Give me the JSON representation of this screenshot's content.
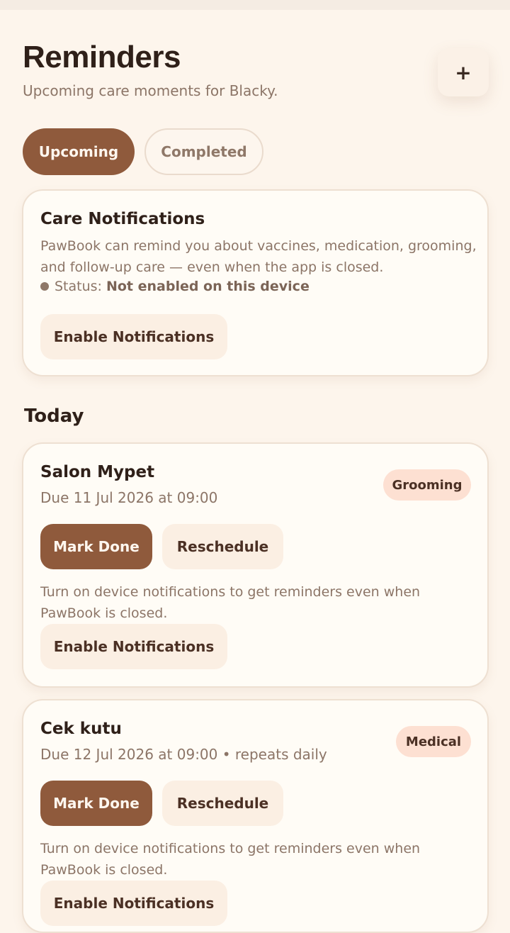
{
  "header": {
    "title": "Reminders",
    "subtitle": "Upcoming care moments for Blacky.",
    "add_label": "+"
  },
  "tabs": [
    {
      "label": "Upcoming",
      "active": true
    },
    {
      "label": "Completed",
      "active": false
    }
  ],
  "notifications_card": {
    "title": "Care Notifications",
    "description": "PawBook can remind you about vaccines, medication, grooming, and follow-up care — even when the app is closed.",
    "status_label": "Status:",
    "status_value": "Not enabled on this device",
    "button_label": "Enable Notifications"
  },
  "section": {
    "heading": "Today"
  },
  "reminders": [
    {
      "title": "Salon Mypet",
      "due": "Due 11 Jul 2026 at 09:00",
      "category": "Grooming",
      "done_label": "Mark Done",
      "reschedule_label": "Reschedule",
      "hint": "Turn on device notifications to get reminders even when PawBook is closed.",
      "enable_label": "Enable Notifications"
    },
    {
      "title": "Cek kutu",
      "due": "Due 12 Jul 2026 at 09:00 • repeats daily",
      "category": "Medical",
      "done_label": "Mark Done",
      "reschedule_label": "Reschedule",
      "hint": "Turn on device notifications to get reminders even when PawBook is closed.",
      "enable_label": "Enable Notifications"
    }
  ],
  "colors": {
    "background": "#fdf5ec",
    "primary": "#8f5a3c",
    "badge": "#fde0d2",
    "secondary_button": "#fbefe3"
  }
}
